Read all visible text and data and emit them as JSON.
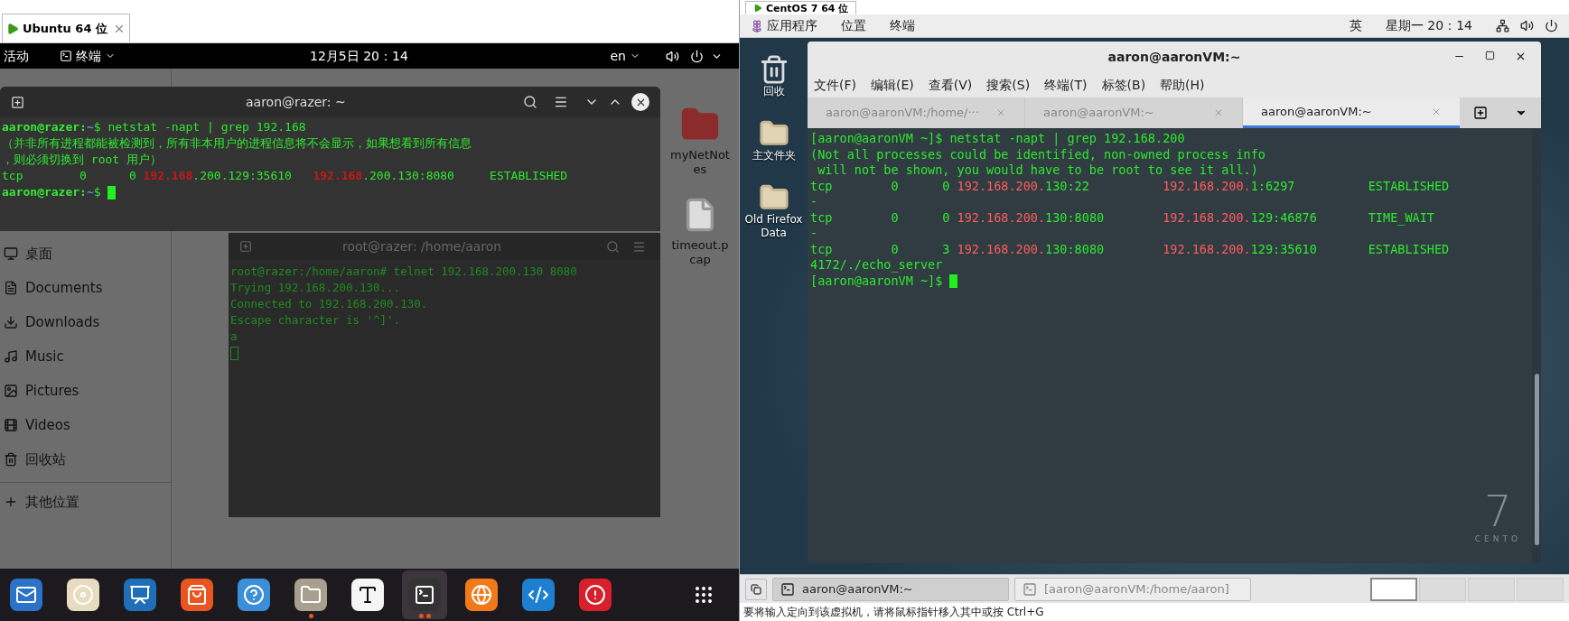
{
  "ubuntu_vm": {
    "tab": {
      "title": "Ubuntu 64 位"
    },
    "top_bar": {
      "activities": "活动",
      "app_menu": "终端",
      "clock": "12月5日  20：14",
      "input_method": "en"
    },
    "files_sidebar": [
      {
        "label": "桌面"
      },
      {
        "label": "Documents"
      },
      {
        "label": "Downloads"
      },
      {
        "label": "Music"
      },
      {
        "label": "Pictures"
      },
      {
        "label": "Videos"
      },
      {
        "label": "回收站"
      },
      {
        "label": "其他位置"
      }
    ],
    "files_grid": [
      {
        "name": "myNetNotes",
        "kind": "folder"
      },
      {
        "name": "timeout.pcap",
        "kind": "file"
      }
    ],
    "terminal": {
      "title": "aaron@razer: ~",
      "lines": [
        [
          {
            "text": "aaron@razer",
            "kind": "prompt"
          },
          {
            "text": ":",
            "kind": "prompt"
          },
          {
            "text": "~",
            "kind": "path"
          },
          {
            "text": "$ netstat -napt | grep 192.168",
            "kind": "text"
          }
        ],
        [
          {
            "text": "（并非所有进程都能被检测到，所有非本用户的进程信息将不会显示，如果想看到所有信息",
            "kind": "text"
          }
        ],
        [
          {
            "text": "，则必须切换到 root 用户）",
            "kind": "text"
          }
        ],
        [
          {
            "text": "tcp        0      0 ",
            "kind": "text"
          },
          {
            "text": "192.168",
            "kind": "match_bold"
          },
          {
            "text": ".200.129:35610   ",
            "kind": "text"
          },
          {
            "text": "192.168",
            "kind": "match_bold"
          },
          {
            "text": ".200.130:8080     ESTABLISHED",
            "kind": "text"
          }
        ],
        [
          {
            "text": "aaron@razer",
            "kind": "prompt"
          },
          {
            "text": ":",
            "kind": "prompt"
          },
          {
            "text": "~",
            "kind": "path"
          },
          {
            "text": "$ ",
            "kind": "text"
          },
          {
            "kind": "cursor"
          }
        ]
      ]
    },
    "root_terminal": {
      "title": "root@razer: /home/aaron",
      "lines": [
        [
          {
            "text": "root@razer:/home/aaron# telnet 192.168.200.130 8080",
            "kind": "dim"
          }
        ],
        [
          {
            "text": "Trying 192.168.200.130...",
            "kind": "dim"
          }
        ],
        [
          {
            "text": "Connected to 192.168.200.130.",
            "kind": "dim"
          }
        ],
        [
          {
            "text": "Escape character is '^]'.",
            "kind": "dim"
          }
        ],
        [
          {
            "text": "a",
            "kind": "dim"
          }
        ],
        [
          {
            "kind": "cursor_hollow"
          }
        ]
      ]
    },
    "dock": [
      {
        "running": false,
        "selected": false
      },
      {
        "running": false,
        "selected": false
      },
      {
        "running": false,
        "selected": false
      },
      {
        "running": false,
        "selected": false
      },
      {
        "running": false,
        "selected": false
      },
      {
        "running": true,
        "selected": false
      },
      {
        "running": false,
        "selected": false
      },
      {
        "running": true,
        "selected": true
      },
      {
        "running": false,
        "selected": false
      },
      {
        "running": false,
        "selected": false
      },
      {
        "running": false,
        "selected": false
      },
      {
        "running": false,
        "selected": false
      }
    ]
  },
  "centos_vm": {
    "tab": {
      "title": "CentOS 7 64 位"
    },
    "panel": {
      "menus": [
        "应用程序",
        "位置",
        "终端"
      ],
      "input_method": "英",
      "clock": "星期一 20：14"
    },
    "desktop_icons": [
      {
        "label": "回收",
        "kind": "trash"
      },
      {
        "label": "主文件夹",
        "kind": "folder"
      },
      {
        "label": "Old Firefox Data",
        "kind": "folder"
      }
    ],
    "terminal": {
      "title": "aaron@aaronVM:~",
      "menu": [
        "文件(F)",
        "编辑(E)",
        "查看(V)",
        "搜索(S)",
        "终端(T)",
        "标签(B)",
        "帮助(H)"
      ],
      "tabs": [
        {
          "label": "aaron@aaronVM:/home/···",
          "selected": false
        },
        {
          "label": "aaron@aaronVM:~",
          "selected": false
        },
        {
          "label": "aaron@aaronVM:~",
          "selected": true
        }
      ],
      "lines": [
        [
          {
            "text": "[aaron@aaronVM ~]$ netstat -napt | grep 192.168.200",
            "kind": "text"
          }
        ],
        [
          {
            "text": "(Not all processes could be identified, non-owned process info",
            "kind": "text"
          }
        ],
        [
          {
            "text": " will not be shown, you would have to be root to see it all.)",
            "kind": "text"
          }
        ],
        [
          {
            "text": "tcp        0      0 ",
            "kind": "text"
          },
          {
            "text": "192.168.200.",
            "kind": "match"
          },
          {
            "text": "130:22          ",
            "kind": "text"
          },
          {
            "text": "192.168.200.",
            "kind": "match"
          },
          {
            "text": "1:6297          ESTABLISHED",
            "kind": "text"
          }
        ],
        [
          {
            "text": "-",
            "kind": "text"
          }
        ],
        [
          {
            "text": "tcp        0      0 ",
            "kind": "text"
          },
          {
            "text": "192.168.200.",
            "kind": "match"
          },
          {
            "text": "130:8080        ",
            "kind": "text"
          },
          {
            "text": "192.168.200.",
            "kind": "match"
          },
          {
            "text": "129:46876       TIME_WAIT",
            "kind": "text"
          }
        ],
        [
          {
            "text": "-",
            "kind": "text"
          }
        ],
        [
          {
            "text": "tcp        0      3 ",
            "kind": "text"
          },
          {
            "text": "192.168.200.",
            "kind": "match"
          },
          {
            "text": "130:8080        ",
            "kind": "text"
          },
          {
            "text": "192.168.200.",
            "kind": "match"
          },
          {
            "text": "129:35610       ESTABLISHED",
            "kind": "text"
          }
        ],
        [
          {
            "text": "4172/./echo_server",
            "kind": "text"
          }
        ],
        [
          {
            "text": "[aaron@aaronVM ~]$ ",
            "kind": "text"
          },
          {
            "kind": "cursor"
          }
        ]
      ]
    },
    "logo": {
      "number": "7",
      "word": "CENTO"
    },
    "taskbar": {
      "tasks": [
        {
          "label": "aaron@aaronVM:~",
          "selected": true
        },
        {
          "label": "[aaron@aaronVM:/home/aaron]",
          "selected": false
        }
      ],
      "workspaces": [
        {
          "selected": true
        },
        {
          "selected": false
        },
        {
          "selected": false
        },
        {
          "selected": false
        }
      ]
    }
  },
  "vmware_status": "要将输入定向到该虚拟机，请将鼠标指针移入其中或按 Ctrl+G"
}
